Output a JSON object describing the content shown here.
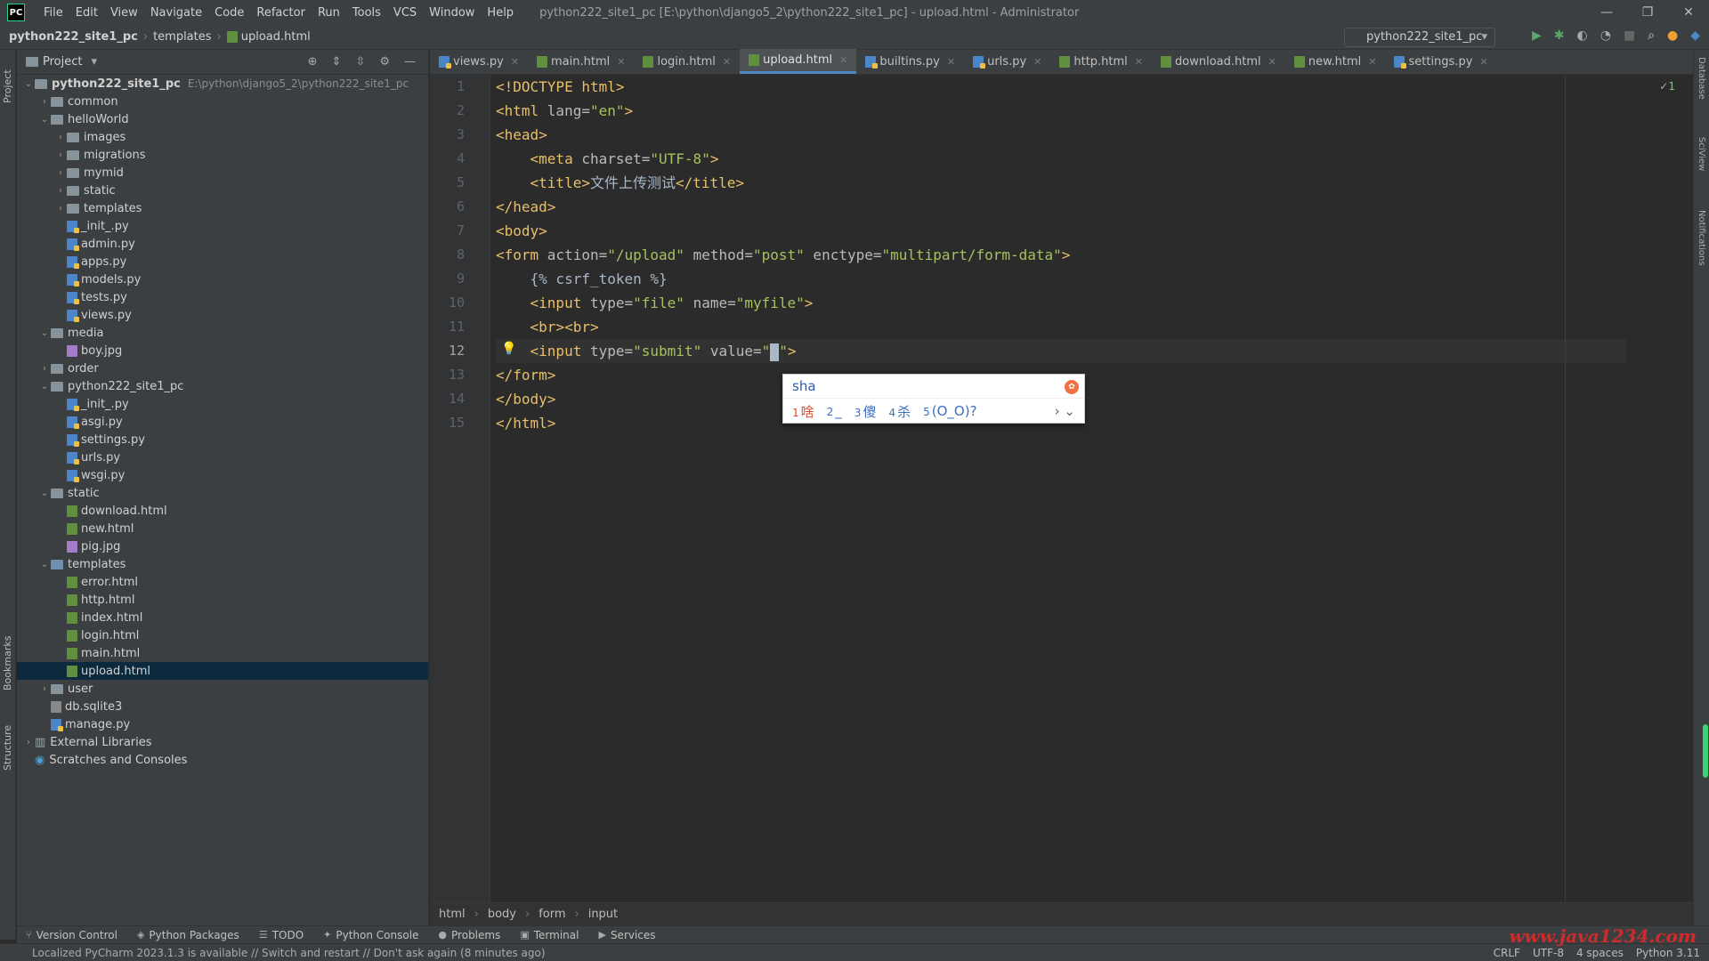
{
  "app": {
    "logo": "PC",
    "menu": [
      "File",
      "Edit",
      "View",
      "Navigate",
      "Code",
      "Refactor",
      "Run",
      "Tools",
      "VCS",
      "Window",
      "Help"
    ],
    "window_title": "python222_site1_pc [E:\\python\\django5_2\\python222_site1_pc] - upload.html - Administrator",
    "window_buttons": [
      "—",
      "❐",
      "✕"
    ]
  },
  "navbar": {
    "crumbs": [
      "python222_site1_pc",
      "templates",
      "upload.html"
    ],
    "run_config": "python222_site1_pc"
  },
  "project_panel": {
    "title": "Project",
    "tree": [
      {
        "label": "python222_site1_pc",
        "hint": "E:\\python\\django5_2\\python222_site1_pc",
        "depth": 0,
        "type": "folder",
        "open": true,
        "bold": true
      },
      {
        "label": "common",
        "depth": 1,
        "type": "folder",
        "open": false
      },
      {
        "label": "helloWorld",
        "depth": 1,
        "type": "folder",
        "open": true
      },
      {
        "label": "images",
        "depth": 2,
        "type": "folder",
        "open": false
      },
      {
        "label": "migrations",
        "depth": 2,
        "type": "folder",
        "open": false
      },
      {
        "label": "mymid",
        "depth": 2,
        "type": "folder",
        "open": false
      },
      {
        "label": "static",
        "depth": 2,
        "type": "folder",
        "open": false
      },
      {
        "label": "templates",
        "depth": 2,
        "type": "folder",
        "open": false
      },
      {
        "label": "_init_.py",
        "depth": 2,
        "type": "py"
      },
      {
        "label": "admin.py",
        "depth": 2,
        "type": "py"
      },
      {
        "label": "apps.py",
        "depth": 2,
        "type": "py"
      },
      {
        "label": "models.py",
        "depth": 2,
        "type": "py"
      },
      {
        "label": "tests.py",
        "depth": 2,
        "type": "py"
      },
      {
        "label": "views.py",
        "depth": 2,
        "type": "py"
      },
      {
        "label": "media",
        "depth": 1,
        "type": "folder",
        "open": true
      },
      {
        "label": "boy.jpg",
        "depth": 2,
        "type": "img"
      },
      {
        "label": "order",
        "depth": 1,
        "type": "folder",
        "open": false
      },
      {
        "label": "python222_site1_pc",
        "depth": 1,
        "type": "folder",
        "open": true
      },
      {
        "label": "_init_.py",
        "depth": 2,
        "type": "py"
      },
      {
        "label": "asgi.py",
        "depth": 2,
        "type": "py"
      },
      {
        "label": "settings.py",
        "depth": 2,
        "type": "py"
      },
      {
        "label": "urls.py",
        "depth": 2,
        "type": "py"
      },
      {
        "label": "wsgi.py",
        "depth": 2,
        "type": "py"
      },
      {
        "label": "static",
        "depth": 1,
        "type": "folder",
        "open": true
      },
      {
        "label": "download.html",
        "depth": 2,
        "type": "html"
      },
      {
        "label": "new.html",
        "depth": 2,
        "type": "html"
      },
      {
        "label": "pig.jpg",
        "depth": 2,
        "type": "img"
      },
      {
        "label": "templates",
        "depth": 1,
        "type": "folder-blue",
        "open": true
      },
      {
        "label": "error.html",
        "depth": 2,
        "type": "html"
      },
      {
        "label": "http.html",
        "depth": 2,
        "type": "html"
      },
      {
        "label": "index.html",
        "depth": 2,
        "type": "html"
      },
      {
        "label": "login.html",
        "depth": 2,
        "type": "html"
      },
      {
        "label": "main.html",
        "depth": 2,
        "type": "html"
      },
      {
        "label": "upload.html",
        "depth": 2,
        "type": "html",
        "selected": true
      },
      {
        "label": "user",
        "depth": 1,
        "type": "folder",
        "open": false
      },
      {
        "label": "db.sqlite3",
        "depth": 1,
        "type": "db"
      },
      {
        "label": "manage.py",
        "depth": 1,
        "type": "py"
      },
      {
        "label": "External Libraries",
        "depth": 0,
        "type": "lib",
        "open": false
      },
      {
        "label": "Scratches and Consoles",
        "depth": 0,
        "type": "scratch"
      }
    ]
  },
  "tabs": [
    {
      "label": "views.py",
      "type": "py"
    },
    {
      "label": "main.html",
      "type": "html"
    },
    {
      "label": "login.html",
      "type": "html"
    },
    {
      "label": "upload.html",
      "type": "html",
      "active": true
    },
    {
      "label": "builtins.py",
      "type": "py"
    },
    {
      "label": "urls.py",
      "type": "py"
    },
    {
      "label": "http.html",
      "type": "html"
    },
    {
      "label": "download.html",
      "type": "html"
    },
    {
      "label": "new.html",
      "type": "html"
    },
    {
      "label": "settings.py",
      "type": "py"
    }
  ],
  "editor": {
    "inspection": "✓1",
    "current_line": 12,
    "lines": [
      [
        [
          "tag",
          "<!DOCTYPE html>"
        ]
      ],
      [
        [
          "tag",
          "<html "
        ],
        [
          "attr",
          "lang="
        ],
        [
          "str",
          "\"en\""
        ],
        [
          "tag",
          ">"
        ]
      ],
      [
        [
          "tag",
          "<head>"
        ]
      ],
      [
        [
          "txt",
          "    "
        ],
        [
          "tag",
          "<meta "
        ],
        [
          "attr",
          "charset="
        ],
        [
          "str",
          "\"UTF-8\""
        ],
        [
          "tag",
          ">"
        ]
      ],
      [
        [
          "txt",
          "    "
        ],
        [
          "tag",
          "<title>"
        ],
        [
          "txt",
          "文件上传测试"
        ],
        [
          "tag",
          "</title>"
        ]
      ],
      [
        [
          "tag",
          "</head>"
        ]
      ],
      [
        [
          "tag",
          "<body>"
        ]
      ],
      [
        [
          "tag",
          "<form "
        ],
        [
          "attr",
          "action="
        ],
        [
          "str",
          "\"/upload\""
        ],
        [
          "attr",
          " method="
        ],
        [
          "str",
          "\"post\""
        ],
        [
          "attr",
          " enctype="
        ],
        [
          "str",
          "\"multipart/form-data\""
        ],
        [
          "tag",
          ">"
        ]
      ],
      [
        [
          "txt",
          "    {% csrf_token %}"
        ]
      ],
      [
        [
          "txt",
          "    "
        ],
        [
          "tag",
          "<input "
        ],
        [
          "attr",
          "type="
        ],
        [
          "str",
          "\"file\""
        ],
        [
          "attr",
          " name="
        ],
        [
          "str",
          "\"myfile\""
        ],
        [
          "tag",
          ">"
        ]
      ],
      [
        [
          "txt",
          "    "
        ],
        [
          "tag",
          "<br><br>"
        ]
      ],
      [
        [
          "txt",
          "    "
        ],
        [
          "tag",
          "<input "
        ],
        [
          "attr",
          "type="
        ],
        [
          "str",
          "\"submit\""
        ],
        [
          "attr",
          " value="
        ],
        [
          "str",
          "\""
        ],
        [
          "cursor",
          ""
        ],
        [
          "str",
          "\""
        ],
        [
          "tag",
          ">"
        ]
      ],
      [
        [
          "tag",
          "</form>"
        ]
      ],
      [
        [
          "tag",
          "</body>"
        ]
      ],
      [
        [
          "tag",
          "</html>"
        ]
      ]
    ]
  },
  "ime": {
    "input": "sha",
    "candidates": [
      {
        "n": "1",
        "text": "啥"
      },
      {
        "n": "2",
        "text": "_"
      },
      {
        "n": "3",
        "text": "傻"
      },
      {
        "n": "4",
        "text": "杀"
      },
      {
        "n": "5",
        "text": "(O_O)?"
      }
    ],
    "nav": "› ⌄"
  },
  "breadcrumb": [
    "html",
    "body",
    "form",
    "input"
  ],
  "tool_windows": [
    {
      "label": "Version Control",
      "icon": "⑂"
    },
    {
      "label": "Python Packages",
      "icon": "◈"
    },
    {
      "label": "TODO",
      "icon": "☰"
    },
    {
      "label": "Python Console",
      "icon": "✦"
    },
    {
      "label": "Problems",
      "icon": "●"
    },
    {
      "label": "Terminal",
      "icon": "▣"
    },
    {
      "label": "Services",
      "icon": "▶"
    }
  ],
  "left_strip": [
    "Project",
    "Bookmarks",
    "Structure"
  ],
  "right_strip": [
    "Database",
    "SciView",
    "Notifications"
  ],
  "status": {
    "message": "Localized PyCharm 2023.1.3 is available // Switch and restart // Don't ask again (8 minutes ago)",
    "right": [
      "CRLF",
      "UTF-8",
      "4 spaces",
      "Python 3.11"
    ]
  },
  "watermark": "www.java1234.com"
}
